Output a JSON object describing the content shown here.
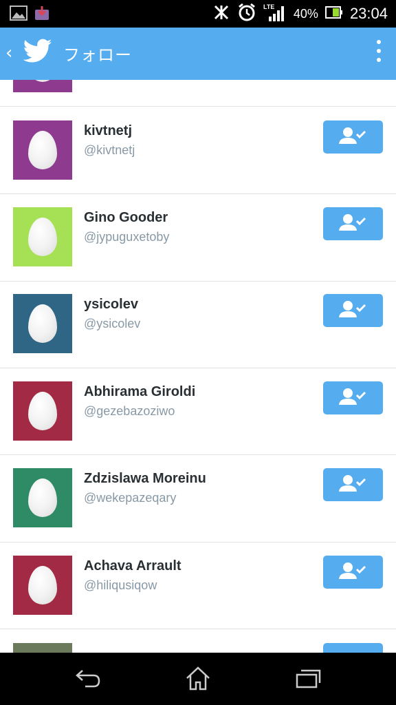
{
  "status_bar": {
    "battery_percent": "40%",
    "time": "23:04",
    "network": "LTE"
  },
  "app_bar": {
    "title": "フォロー"
  },
  "users": [
    {
      "name": "",
      "handle": "",
      "avatar_color": "#8e3a8e"
    },
    {
      "name": "kivtnetj",
      "handle": "@kivtnetj",
      "avatar_color": "#8e3a8e"
    },
    {
      "name": "Gino Gooder",
      "handle": "@jypuguxetoby",
      "avatar_color": "#a6e054"
    },
    {
      "name": "ysicolev",
      "handle": "@ysicolev",
      "avatar_color": "#2f6585"
    },
    {
      "name": "Abhirama Giroldi",
      "handle": "@gezebazoziwo",
      "avatar_color": "#a32a44"
    },
    {
      "name": "Zdzislawa Moreinu",
      "handle": "@wekepazeqary",
      "avatar_color": "#2f8a66"
    },
    {
      "name": "Achava Arrault",
      "handle": "@hiliqusiqow",
      "avatar_color": "#a32a44"
    },
    {
      "name": "",
      "handle": "",
      "avatar_color": "#6b7a5a"
    }
  ],
  "colors": {
    "accent": "#55acee",
    "status_bar": "#000000",
    "nav_bar": "#000000"
  }
}
